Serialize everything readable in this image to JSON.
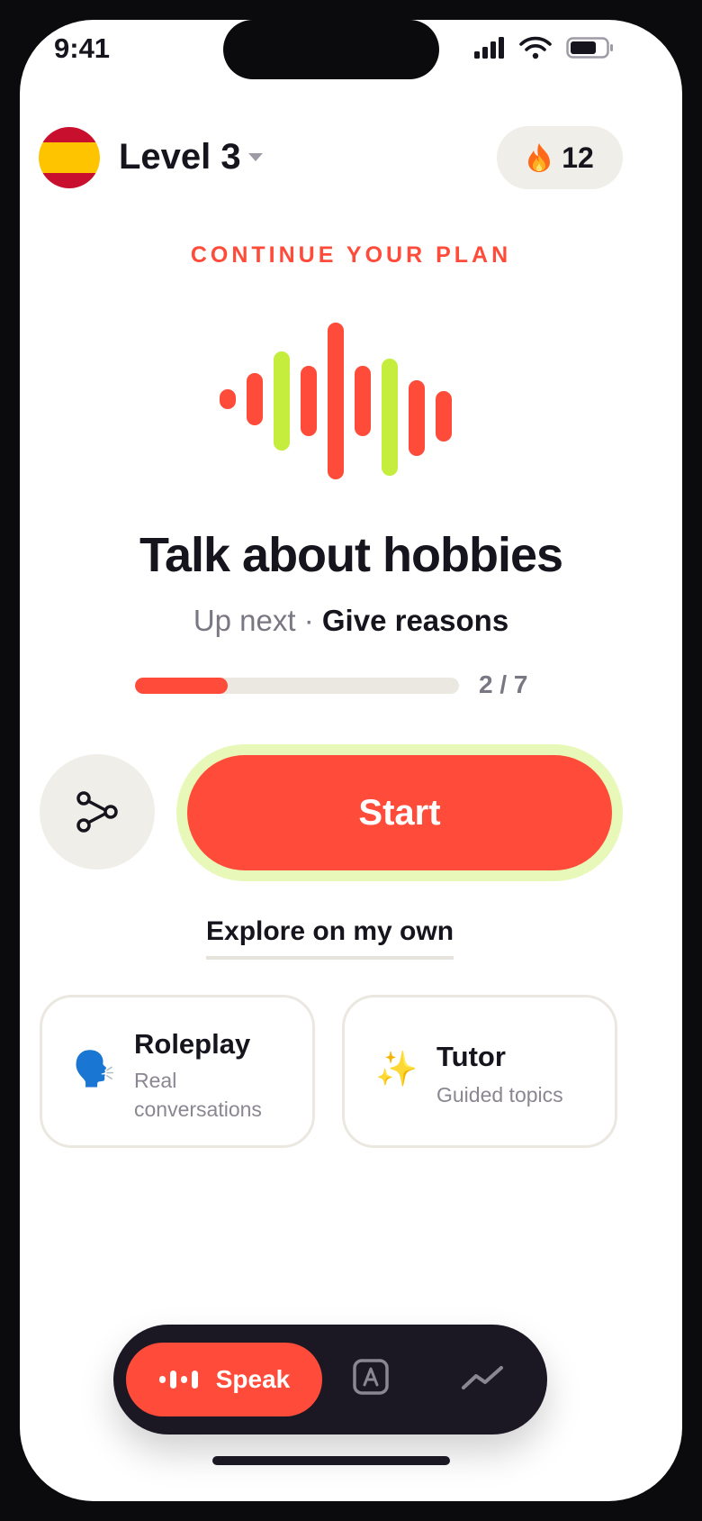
{
  "status_bar": {
    "time": "9:41"
  },
  "header": {
    "level_label": "Level 3",
    "flag_icon": "spain-flag-icon",
    "streak": {
      "icon": "fire-icon",
      "count": "12"
    }
  },
  "plan": {
    "kicker": "CONTINUE YOUR PLAN",
    "lesson_title": "Talk about hobbies",
    "up_next_label": "Up next",
    "separator": "·",
    "up_next_value": "Give reasons",
    "progress": {
      "current": 2,
      "total": 7,
      "label": "2 / 7"
    }
  },
  "actions": {
    "start_label": "Start",
    "explore_label": "Explore on my own"
  },
  "cards": [
    {
      "icon": "speaking-head-icon",
      "emoji": "🗣️",
      "title": "Roleplay",
      "subtitle": "Real conversations"
    },
    {
      "icon": "sparkles-icon",
      "emoji": "✨",
      "title": "Tutor",
      "subtitle": "Guided topics"
    }
  ],
  "tab_bar": {
    "speak_label": "Speak"
  },
  "colors": {
    "accent": "#ff4b3a",
    "lime": "#c4ed3e",
    "dark": "#1b1824",
    "muted": "#7a7682"
  }
}
